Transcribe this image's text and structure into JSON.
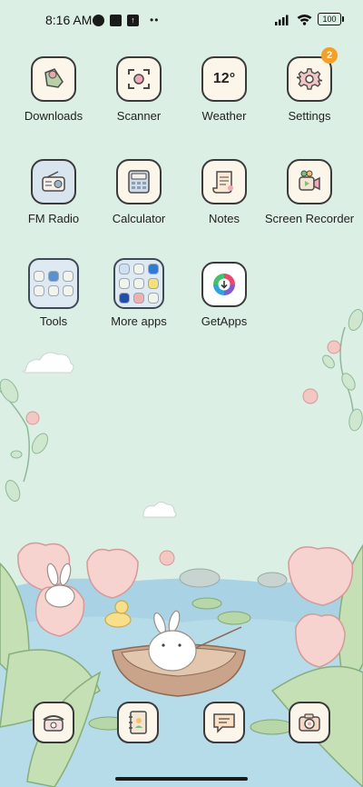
{
  "status": {
    "time": "8:16 AM",
    "battery": "100"
  },
  "apps": [
    {
      "label": "Downloads",
      "icon": "downloads-icon"
    },
    {
      "label": "Scanner",
      "icon": "scanner-icon"
    },
    {
      "label": "Weather",
      "icon": "weather-icon",
      "icon_text": "12°"
    },
    {
      "label": "Settings",
      "icon": "settings-gear-icon",
      "badge": "2"
    },
    {
      "label": "FM Radio",
      "icon": "radio-icon"
    },
    {
      "label": "Calculator",
      "icon": "calculator-icon"
    },
    {
      "label": "Notes",
      "icon": "notes-icon"
    },
    {
      "label": "Screen Recorder",
      "icon": "screen-recorder-icon"
    },
    {
      "label": "Tools",
      "icon": "folder-icon"
    },
    {
      "label": "More apps",
      "icon": "folder-icon"
    },
    {
      "label": "GetApps",
      "icon": "getapps-icon"
    }
  ],
  "dock": [
    {
      "name": "phone",
      "icon": "phone-icon"
    },
    {
      "name": "contacts",
      "icon": "contacts-icon"
    },
    {
      "name": "messages",
      "icon": "messages-icon"
    },
    {
      "name": "camera",
      "icon": "camera-icon"
    }
  ],
  "colors": {
    "background": "#dcefe4",
    "badge": "#f4a028",
    "icon_fill": "#fbf5ea",
    "icon_border": "#3a3a3a"
  }
}
